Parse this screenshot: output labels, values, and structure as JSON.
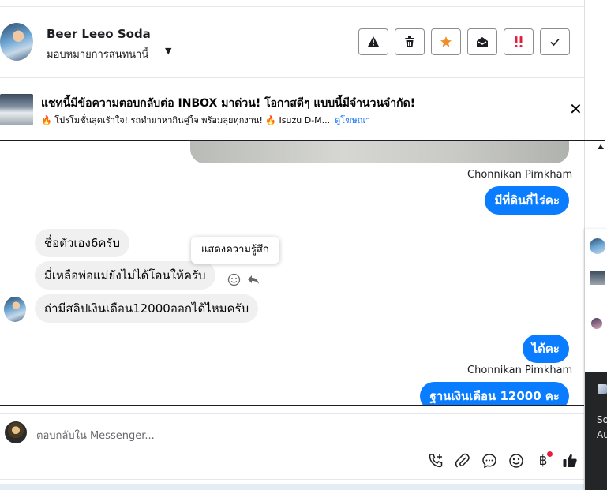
{
  "header": {
    "contact_name": "Beer Leeo Soda",
    "assign_label": "มอบหมายการสนทนานี้",
    "actions": [
      {
        "name": "spam-icon",
        "symbol": "⚠"
      },
      {
        "name": "trash-icon",
        "symbol": "🗑"
      },
      {
        "name": "star-icon",
        "symbol": "★"
      },
      {
        "name": "mark-unread-icon",
        "symbol": "✉"
      },
      {
        "name": "urgent-icon",
        "symbol": "‼"
      },
      {
        "name": "done-icon",
        "symbol": "✓"
      }
    ],
    "accent": "#f28c28",
    "urgent_color": "#e41e3f"
  },
  "ad": {
    "title": "แชทนี้มีข้อความตอบกลับต่อ INBOX มาด่วน! โอกาสดีๆ แบบนี้มีจำนวนจำกัด!",
    "subtitle": "🔥 โปรโมชั่นสุดเร้าใจ! รถทำมาหากินคู่ใจ พร้อมลุยทุกงาน! 🔥 Isuzu D-M...",
    "link": "ดูโฆษณา"
  },
  "thread": {
    "sender_name_1": "Chonnikan Pimkham",
    "out_msg_1": "มีที่ดินกี่ไร่คะ",
    "in_msgs": [
      "ชื่อตัวเอง6ครับ",
      "มี่เหลือพ่อแม่ยังไม่ได้โอนให้ครับ",
      "ถ่ามีสลิปเงินเดือน12000ออกได้ไหมครับ"
    ],
    "tooltip": "แสดงความรู้สึก",
    "out_msg_2": "ได้คะ",
    "sender_name_2": "Chonnikan Pimkham",
    "out_msg_3": "ฐานเงินเดือน 12000 คะ",
    "bubble_color": "#0a7cff"
  },
  "composer": {
    "placeholder": "ตอบกลับใน Messenger...",
    "tools": [
      "call-add-icon",
      "attach-icon",
      "saved-replies-icon",
      "emoji-icon",
      "payment-icon",
      "like-icon"
    ],
    "payment_symbol": "฿"
  },
  "side": {
    "text_1": "So",
    "text_2": "Au"
  }
}
